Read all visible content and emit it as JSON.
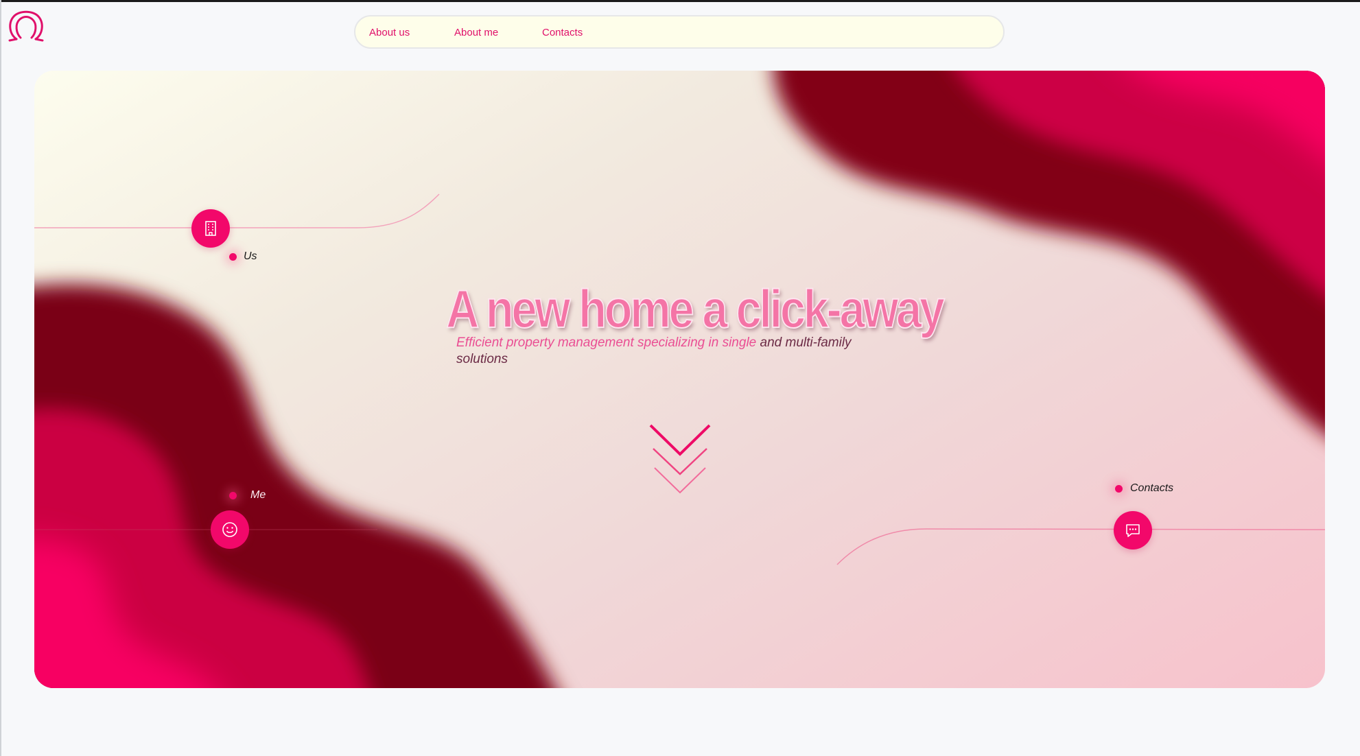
{
  "nav": {
    "items": [
      {
        "label": "About us"
      },
      {
        "label": "About me"
      },
      {
        "label": "Contacts"
      }
    ]
  },
  "hero": {
    "title": "A new home a click-away",
    "subtitle_main": "Efficient property management specializing in single ",
    "subtitle_tail": "and multi-family solutions"
  },
  "nodes": {
    "us": {
      "label": "Us",
      "icon": "building-icon"
    },
    "me": {
      "label": "Me",
      "icon": "smiley-icon"
    },
    "contacts": {
      "label": "Contacts",
      "icon": "chat-bubble-icon"
    }
  },
  "icons": {
    "logo": "horseshoe-logo-icon",
    "scroll": "triple-chevron-down-icon"
  },
  "colors": {
    "accent": "#f2086a",
    "dark_wave": "#820018",
    "mid_wave": "#cc0044",
    "nav_bg": "#fefeea"
  }
}
